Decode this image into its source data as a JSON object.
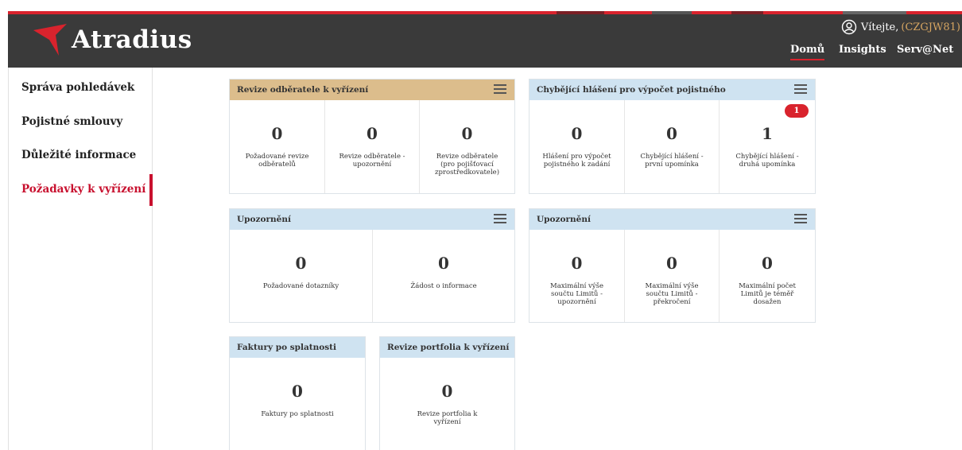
{
  "header": {
    "brand": "Atradius",
    "welcome_text": "Vítejte,",
    "user_code": "(CZGJW81)",
    "nav": [
      {
        "label": "Domů",
        "active": true
      },
      {
        "label": "Insights",
        "active": false
      },
      {
        "label": "Serv@Net",
        "active": false
      }
    ]
  },
  "sidebar": {
    "items": [
      {
        "label": "Správa pohledávek",
        "active": false
      },
      {
        "label": "Pojistné smlouvy",
        "active": false
      },
      {
        "label": "Důležité informace",
        "active": false
      },
      {
        "label": "Požadavky k vyřízení",
        "active": true
      }
    ]
  },
  "cards": [
    {
      "title": "Revize odběratele k vyřízení",
      "metrics": [
        {
          "value": "0",
          "label": "Požadované revize odběratelů"
        },
        {
          "value": "0",
          "label": "Revize odběratele - upozornění"
        },
        {
          "value": "0",
          "label": "Revize odběratele (pro pojišťovací zprostředkovatele)"
        }
      ]
    },
    {
      "title": "Chybějící hlášení pro výpočet pojistného",
      "badge": "1",
      "metrics": [
        {
          "value": "0",
          "label": "Hlášení pro výpočet pojistného k zadání"
        },
        {
          "value": "0",
          "label": "Chybějící hlášení - první upomínka"
        },
        {
          "value": "1",
          "label": "Chybějící hlášení - druhá upomínka"
        }
      ]
    },
    {
      "title": "Upozornění",
      "metrics": [
        {
          "value": "0",
          "label": "Požadované dotazníky"
        },
        {
          "value": "0",
          "label": "Žádost o informace"
        }
      ]
    },
    {
      "title": "Upozornění",
      "metrics": [
        {
          "value": "0",
          "label": "Maximální výše součtu Limitů - upozornění"
        },
        {
          "value": "0",
          "label": "Maximální výše součtu Limitů - překročení"
        },
        {
          "value": "0",
          "label": "Maximální počet Limitů je téměř dosažen"
        }
      ]
    },
    {
      "title": "Faktury po splatnosti",
      "metrics": [
        {
          "value": "0",
          "label": "Faktury po splatnosti"
        }
      ]
    },
    {
      "title": "Revize portfolia k vyřízení",
      "metrics": [
        {
          "value": "0",
          "label": "Revize portfolia k vyřízení"
        }
      ]
    }
  ],
  "colors": {
    "brand_red": "#d9232d",
    "header_bg": "#3a3a3a",
    "card_head_blue": "#cfe3f1",
    "card_head_tan": "#dcbd8c",
    "active_red": "#c8102e",
    "user_code_gold": "#d6a561"
  },
  "icons": {
    "logo": "atradius-logo-icon",
    "user": "user-circle-icon",
    "card_menu": "list-menu-icon"
  }
}
